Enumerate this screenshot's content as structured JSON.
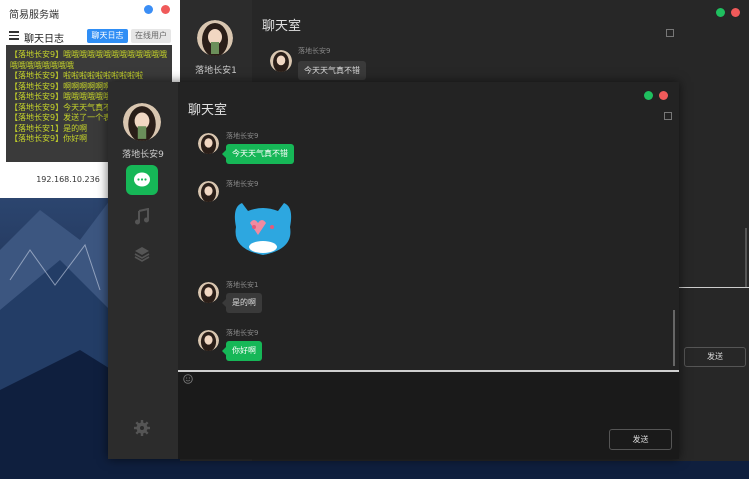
{
  "server_window": {
    "title": "简易服务端",
    "tab_title": "聊天日志",
    "buttons": {
      "chat_log": "聊天日志",
      "online_users": "在线用户"
    },
    "log_lines": [
      "【落地长安9】哦哦哦哦哦哦哦哦哦哦哦哦哦哦哦哦哦哦哦哦哦",
      "【落地长安9】啦啦啦啦啦啦啦啦啦啦",
      "【落地长安9】啊啊啊啊啊啊啊啊啊啊啊啊",
      "【落地长安9】哦哦哦哦哦哦哦哦哦",
      "【落地长安9】今天天气真不错",
      "【落地长安9】发送了一个表情",
      "【落地长安1】是的啊",
      "【落地长安9】你好啊"
    ],
    "ip": "192.168.10.236",
    "colors": {
      "accent": "#2f8ef5",
      "log_text": "#c7d52a",
      "log_bg": "#3a3a3a"
    }
  },
  "back_window": {
    "title": "聊天室",
    "username": "落地长安1",
    "messages": [
      {
        "sender": "落地长安9",
        "text": "今天天气真不错"
      }
    ],
    "send_label": "发送"
  },
  "front_window": {
    "title": "聊天室",
    "username": "落地长安9",
    "nav": [
      "chat-icon",
      "music-icon",
      "layers-icon",
      "gear-icon"
    ],
    "messages": [
      {
        "sender": "落地长安9",
        "text": "今天天气真不错",
        "style": "green"
      },
      {
        "sender": "落地长安9",
        "sticker": "blue-cat-sticker"
      },
      {
        "sender": "落地长安1",
        "text": "是的啊",
        "style": "dark"
      },
      {
        "sender": "落地长安9",
        "text": "你好啊",
        "style": "green"
      }
    ],
    "send_label": "发送",
    "colors": {
      "green": "#16b757",
      "bg": "#1e1e1e",
      "sidebar": "#2c2c2c"
    }
  }
}
